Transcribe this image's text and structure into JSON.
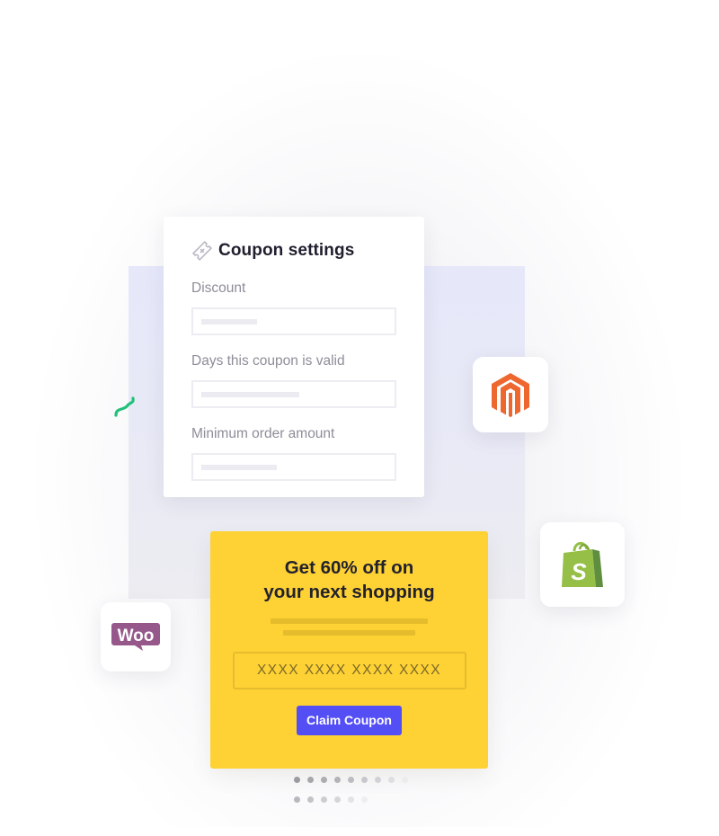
{
  "coupon_settings": {
    "title": "Coupon settings",
    "icon": "ticket-icon",
    "fields": [
      {
        "label": "Discount",
        "placeholder_fill": 0.27
      },
      {
        "label": "Days this coupon is valid",
        "placeholder_fill": 0.48
      },
      {
        "label": "Minimum order amount",
        "placeholder_fill": 0.37
      }
    ]
  },
  "promo": {
    "headline_line1": "Get 60% off on",
    "headline_line2": "your next shopping",
    "code_placeholder": "XXXX XXXX XXXX XXXX",
    "claim_label": "Claim Coupon"
  },
  "integrations": [
    {
      "name": "Magento",
      "icon": "magento-logo-icon",
      "color": "#ee672f"
    },
    {
      "name": "Shopify",
      "icon": "shopify-logo-icon",
      "color": "#95bf47"
    },
    {
      "name": "WooCommerce",
      "icon": "woocommerce-logo-icon",
      "color": "#96588a",
      "text": "Woo"
    }
  ],
  "colors": {
    "promo_bg": "#fed134",
    "button_bg": "#544ef5",
    "accent_green": "#22c07a"
  },
  "pagination": {
    "row1_count": 9,
    "row2_count": 6
  }
}
